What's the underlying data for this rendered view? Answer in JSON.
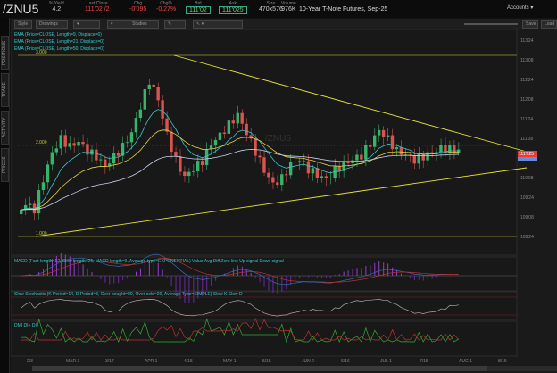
{
  "header": {
    "symbol": "/ZNU5",
    "quotes": [
      {
        "label": "% Yield",
        "value": "4.2",
        "color": "#ccc"
      },
      {
        "label": "Last Close",
        "value": "111'02 /2",
        "color": "#e44"
      },
      {
        "label": "Chg",
        "value": "-0'095",
        "color": "#e44"
      },
      {
        "label": "Chg%",
        "value": "-0.27%",
        "color": "#e44"
      },
      {
        "label": "Bid",
        "value": "111'02",
        "color": "#6d6"
      },
      {
        "label": "Ask",
        "value": "111'025",
        "color": "#6d6"
      },
      {
        "label": "Size",
        "value": "470x576",
        "color": "#ccc"
      },
      {
        "label": "Volume",
        "value": "976K",
        "color": "#ccc"
      }
    ],
    "description": "10-Year T-Note Futures, Sep-25",
    "accounts": "Accounts"
  },
  "sidebar": [
    "POSITIONS",
    "TRADE",
    "ACTIVITY",
    "PRICES"
  ],
  "toolbar": {
    "style": "Style",
    "drawings": "Drawings",
    "studies": "Studies",
    "save": "Save",
    "load": "Load"
  },
  "studies": {
    "ema1": "EMA (Price=CLOSE, Length=9, Displace=0)",
    "ema2": "EMA (Price=CLOSE, Length=21, Displace=0)",
    "ema3": "EMA (Price=CLOSE, Length=50, Displace=0)",
    "macd": "MACD (Fast length=12, Slow length=26, MACD length=9, Average type=EXPONENTIAL)  Value  Avg  Diff  Zero line  Up signal  Down signal",
    "stoch": "Slow Stochastic (K Period=14, D Period=3, Over bought=80, Over sold=20, Average Type=SIMPLE)  Slow K  Slow D",
    "dmi": "DMI  DI+  DI-"
  },
  "chart": {
    "watermark": "/ZNU5",
    "fib_labels": [
      "3.000",
      "2.000",
      "1.000"
    ],
    "closes": [
      109.11,
      109.35,
      109.23,
      110.09,
      110.82,
      111.18,
      110.94,
      111.06,
      110.82,
      110.7,
      110.45,
      110.7,
      110.94,
      111.3,
      112.04,
      112.77,
      112.28,
      111.3,
      110.57,
      110.09,
      110.33,
      110.57,
      111.06,
      111.3,
      111.55,
      111.79,
      111.3,
      110.82,
      110.33,
      109.96,
      110.09,
      110.45,
      110.57,
      110.33,
      110.21,
      110.09,
      110.33,
      110.45,
      110.57,
      110.7,
      111.06,
      111.43,
      111.18,
      110.82,
      110.7,
      110.57,
      110.7,
      110.82,
      110.94,
      110.87,
      110.82
    ],
    "price_ticks": [
      "113'24",
      "113'08",
      "112'24",
      "112'08",
      "111'24",
      "111'08",
      "110'24",
      "110'08",
      "109'24",
      "109'08",
      "108'24"
    ],
    "last_price": "111'025",
    "x_labels": [
      "2/3",
      "MAR 3",
      "3/17",
      "APR 1",
      "4/15",
      "MAY 1",
      "5/15",
      "JUN 2",
      "6/16",
      "JUL 1",
      "7/15",
      "AUG 1",
      "8/15"
    ]
  },
  "colors": {
    "up": "#3ab36a",
    "down": "#d9534f",
    "ema9": "#37c8c8",
    "ema21": "#e6d23c",
    "ema50": "#c8d0f0",
    "trend": "#e6e23c"
  }
}
